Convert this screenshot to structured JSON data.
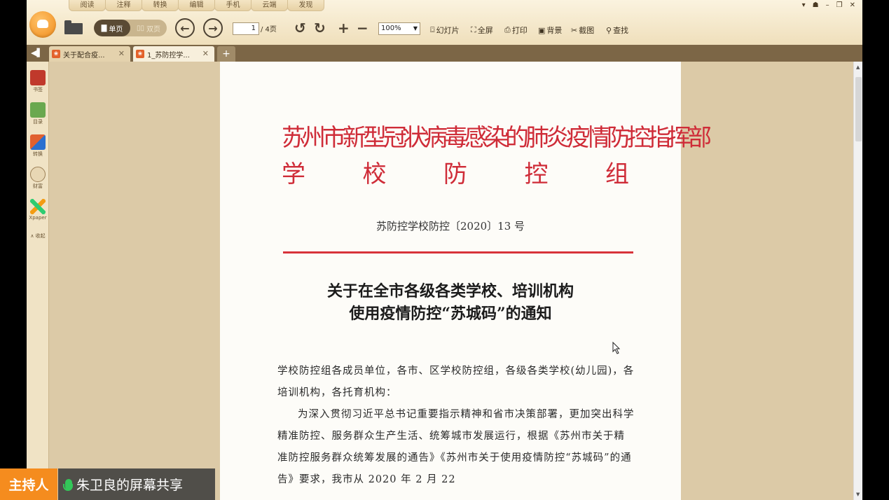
{
  "menu": {
    "tabs": [
      "阅读",
      "注释",
      "转换",
      "编辑",
      "手机",
      "云端",
      "发现"
    ]
  },
  "window_controls": [
    "▾",
    "☗",
    "–",
    "❐",
    "✕"
  ],
  "toolbar": {
    "single_page": "单页",
    "double_page": "双页",
    "page_current": "1",
    "page_total": "/ 4页",
    "zoom": "100%",
    "slideshow": "幻灯片",
    "fullscreen": "全屏",
    "print": "打印",
    "background": "背景",
    "screenshot": "截图",
    "search": "查找"
  },
  "tabs": [
    {
      "label": "关于配合疫..."
    },
    {
      "label": "1_苏防控学..."
    }
  ],
  "sidebar": {
    "items": [
      {
        "label": "书签",
        "color": "#c0392b"
      },
      {
        "label": "目录",
        "color": "#6aa84f"
      },
      {
        "label": "转换",
        "color": "#e06030"
      },
      {
        "label": "财富",
        "color": "#c9a46a"
      },
      {
        "label": "Xpaper",
        "color": "#2ecc71"
      }
    ],
    "collapse": "∧ 收起"
  },
  "document": {
    "header_line1": "苏州市新型冠状病毒感染的肺炎疫情防控指挥部",
    "header_line2": [
      "学",
      "校",
      "防",
      "控",
      "组"
    ],
    "doc_number": "苏防控学校防控〔2020〕13 号",
    "title_line1": "关于在全市各级各类学校、培训机构",
    "title_line2": "使用疫情防控“苏城码”的通知",
    "para1": "学校防控组各成员单位，各市、区学校防控组，各级各类学校(幼儿园)，各培训机构，各托育机构：",
    "para2": "为深入贯彻习近平总书记重要指示精神和省市决策部署，更加突出科学精准防控、服务群众生产生活、统筹城市发展运行，根据《苏州市关于精准防控服务群众统筹发展的通告》《苏州市关于使用疫情防控“苏城码”的通告》要求，我市从 2020 年 2 月 22"
  },
  "meeting": {
    "host_label": "主持人",
    "share_label": "朱卫良的屏幕共享"
  }
}
